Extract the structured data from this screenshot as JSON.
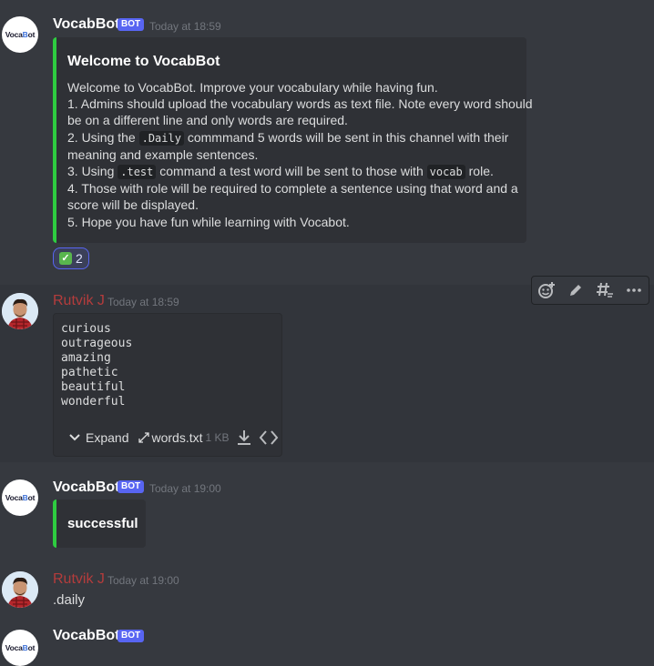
{
  "messages": {
    "m1": {
      "username": "VocabBot",
      "bot_tag": "BOT",
      "timestamp": "Today at 18:59",
      "avatar_text": "VocaBot",
      "embed": {
        "title": "Welcome to VocabBot",
        "lines": [
          "Welcome to VocabBot. Improve your vocabulary while having fun.",
          "1. Admins should upload the vocabulary words as text file. Note every word should",
          "be on a different line and only words are required.",
          "meaning and example sentences.",
          "4. Those with role will be required to complete a sentence using that word and a",
          "score will be displayed.",
          "5. Hope you have fun while learning with Vocabot."
        ],
        "line_daily": {
          "before": "2. Using the ",
          "code": ".Daily",
          "after": " commmand 5 words will be sent in this channel with their"
        },
        "line_test": {
          "before": "3. Using ",
          "code": ".test",
          "middle": " command a test word will be sent to those with ",
          "code2": "vocab",
          "after": " role."
        },
        "color": "#2ecc40"
      },
      "reaction": {
        "emoji": "✓",
        "count": "2"
      }
    },
    "m2": {
      "username": "Rutvik J",
      "timestamp": "Today at 18:59",
      "file": {
        "content": "curious\noutrageous\namazing\npathetic\nbeautiful\nwonderful",
        "expand_label": "Expand",
        "filename": "words.txt",
        "size": "1 KB"
      }
    },
    "m3": {
      "username": "VocabBot",
      "bot_tag": "BOT",
      "timestamp": "Today at 19:00",
      "avatar_text": "VocaBot",
      "embed_text": "successful",
      "color": "#2ecc40"
    },
    "m4": {
      "username": "Rutvik J",
      "timestamp": "Today at 19:00",
      "text": ".daily"
    },
    "m5": {
      "username": "VocabBot",
      "bot_tag": "BOT"
    }
  },
  "toolbar": {
    "icons": [
      "add-reaction-icon",
      "edit-icon",
      "thread-icon",
      "more-icon"
    ]
  },
  "colors": {
    "background": "#36393f",
    "embed_bg": "#2f3136",
    "bot_tag": "#5865f2",
    "embed_border": "#2ecc40",
    "user_name": "#b43c3c"
  }
}
